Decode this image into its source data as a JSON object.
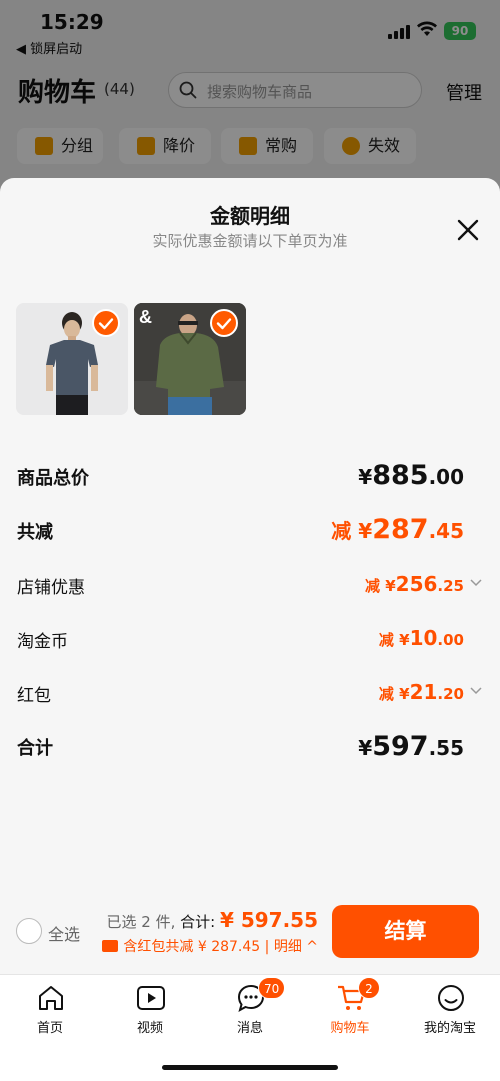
{
  "status_bar": {
    "time": "15:29",
    "back_app": "◀ 锁屏启动",
    "battery": "90"
  },
  "header": {
    "title": "购物车",
    "count": "(44)",
    "search_placeholder": "搜索购物车商品",
    "manage": "管理"
  },
  "chips": [
    {
      "label": "分组",
      "icon": "folder-icon"
    },
    {
      "label": "降价",
      "icon": "price-down-icon"
    },
    {
      "label": "常购",
      "icon": "cart-icon"
    },
    {
      "label": "失效",
      "icon": "expired-icon"
    }
  ],
  "sheet": {
    "title": "金额明细",
    "subtitle": "实际优惠金额请以下单页为准",
    "products": [
      {
        "name": "gray-tshirt",
        "selected": true
      },
      {
        "name": "green-jacket",
        "selected": true
      }
    ],
    "rows": [
      {
        "label": "商品总价",
        "prefix": "",
        "yuan": "¥",
        "int": "885",
        "dec": ".00",
        "style": "total",
        "chevron": false
      },
      {
        "label": "共减",
        "prefix": "减 ",
        "yuan": "¥",
        "int": "287",
        "dec": ".45",
        "style": "reduce",
        "chevron": false
      },
      {
        "label": "店铺优惠",
        "prefix": "减 ",
        "yuan": "¥",
        "int": "256",
        "dec": ".25",
        "style": "sub",
        "chevron": true
      },
      {
        "label": "淘金币",
        "prefix": "减 ",
        "yuan": "¥",
        "int": "10",
        "dec": ".00",
        "style": "sub",
        "chevron": false
      },
      {
        "label": "红包",
        "prefix": "减 ",
        "yuan": "¥",
        "int": "21",
        "dec": ".20",
        "style": "sub",
        "chevron": true
      },
      {
        "label": "合计",
        "prefix": "",
        "yuan": "¥",
        "int": "597",
        "dec": ".55",
        "style": "total",
        "chevron": false
      }
    ]
  },
  "checkout": {
    "select_all": "全选",
    "selected_text": "已选 2 件, ",
    "total_label": "合计: ",
    "total_amount": "¥ 597.55",
    "discount_text": "含红包共减 ¥ 287.45 | 明细 ^",
    "pay_button": "结算"
  },
  "tabbar": [
    {
      "label": "首页",
      "icon": "home-icon",
      "badge": ""
    },
    {
      "label": "视频",
      "icon": "video-icon",
      "badge": ""
    },
    {
      "label": "消息",
      "icon": "message-icon",
      "badge": "70"
    },
    {
      "label": "购物车",
      "icon": "cart-icon",
      "badge": "2",
      "active": true
    },
    {
      "label": "我的淘宝",
      "icon": "profile-icon",
      "badge": ""
    }
  ],
  "colors": {
    "accent": "#ff5000",
    "check": "#ff5a00",
    "battery": "#34c759"
  }
}
